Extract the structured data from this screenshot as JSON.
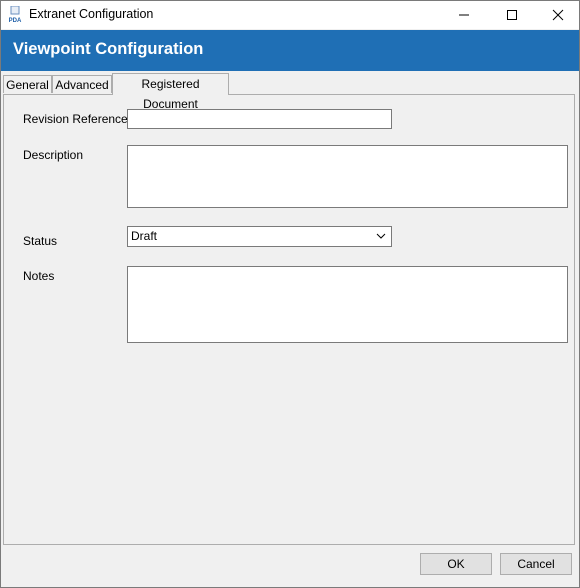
{
  "window": {
    "title": "Extranet Configuration",
    "icon": "pda-app-icon"
  },
  "banner": {
    "title": "Viewpoint Configuration"
  },
  "tabs": [
    {
      "label": "General"
    },
    {
      "label": "Advanced"
    },
    {
      "label": "Registered Document",
      "active": true
    }
  ],
  "form": {
    "revision_reference": {
      "label": "Revision Reference",
      "value": ""
    },
    "description": {
      "label": "Description",
      "value": ""
    },
    "status": {
      "label": "Status",
      "value": "Draft"
    },
    "notes": {
      "label": "Notes",
      "value": ""
    }
  },
  "buttons": {
    "ok": "OK",
    "cancel": "Cancel"
  },
  "colors": {
    "banner": "#1f6fb5",
    "banner_text": "#ffffff"
  }
}
